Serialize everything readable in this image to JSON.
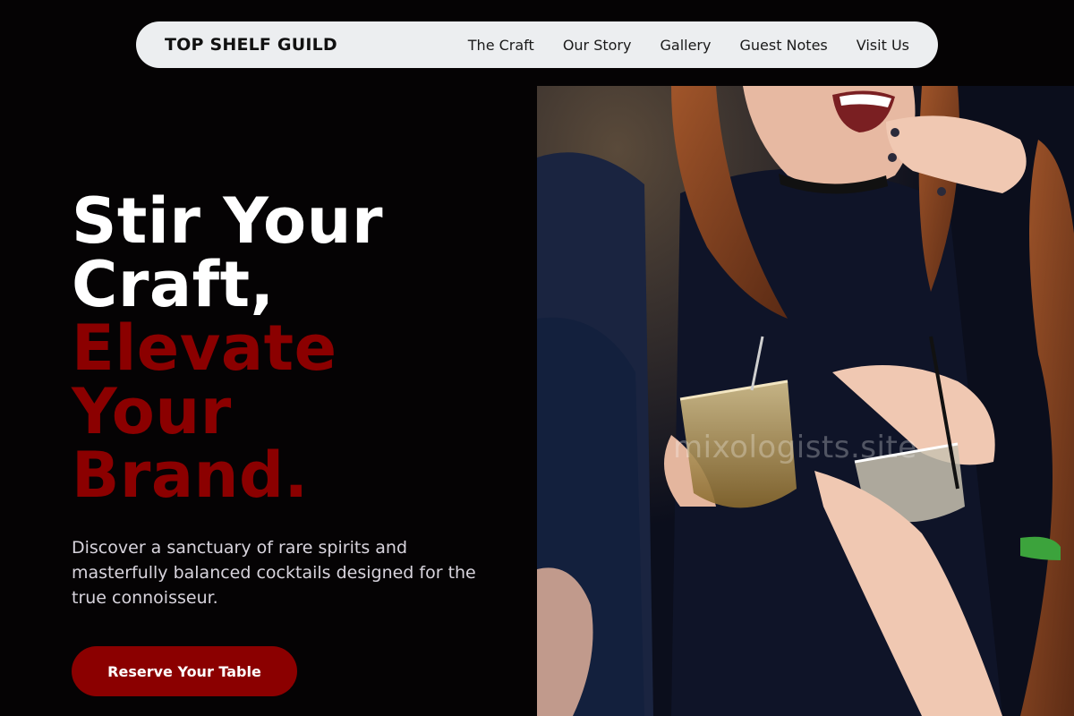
{
  "nav": {
    "brand": "TOP SHELF GUILD",
    "links": [
      "The Craft",
      "Our Story",
      "Gallery",
      "Guest Notes",
      "Visit Us"
    ]
  },
  "hero": {
    "title_white": [
      "Stir Your",
      "Craft,"
    ],
    "title_red": [
      "Elevate",
      "Your",
      "Brand."
    ],
    "subtitle": "Discover a sanctuary of rare spirits and masterfully balanced cocktails designed for the true connoisseur.",
    "cta_label": "Reserve Your Table"
  },
  "photo": {
    "watermark": "mixologists.site"
  },
  "colors": {
    "accent": "#8b0000",
    "background": "#050304",
    "nav_bg": "#eceef0"
  }
}
